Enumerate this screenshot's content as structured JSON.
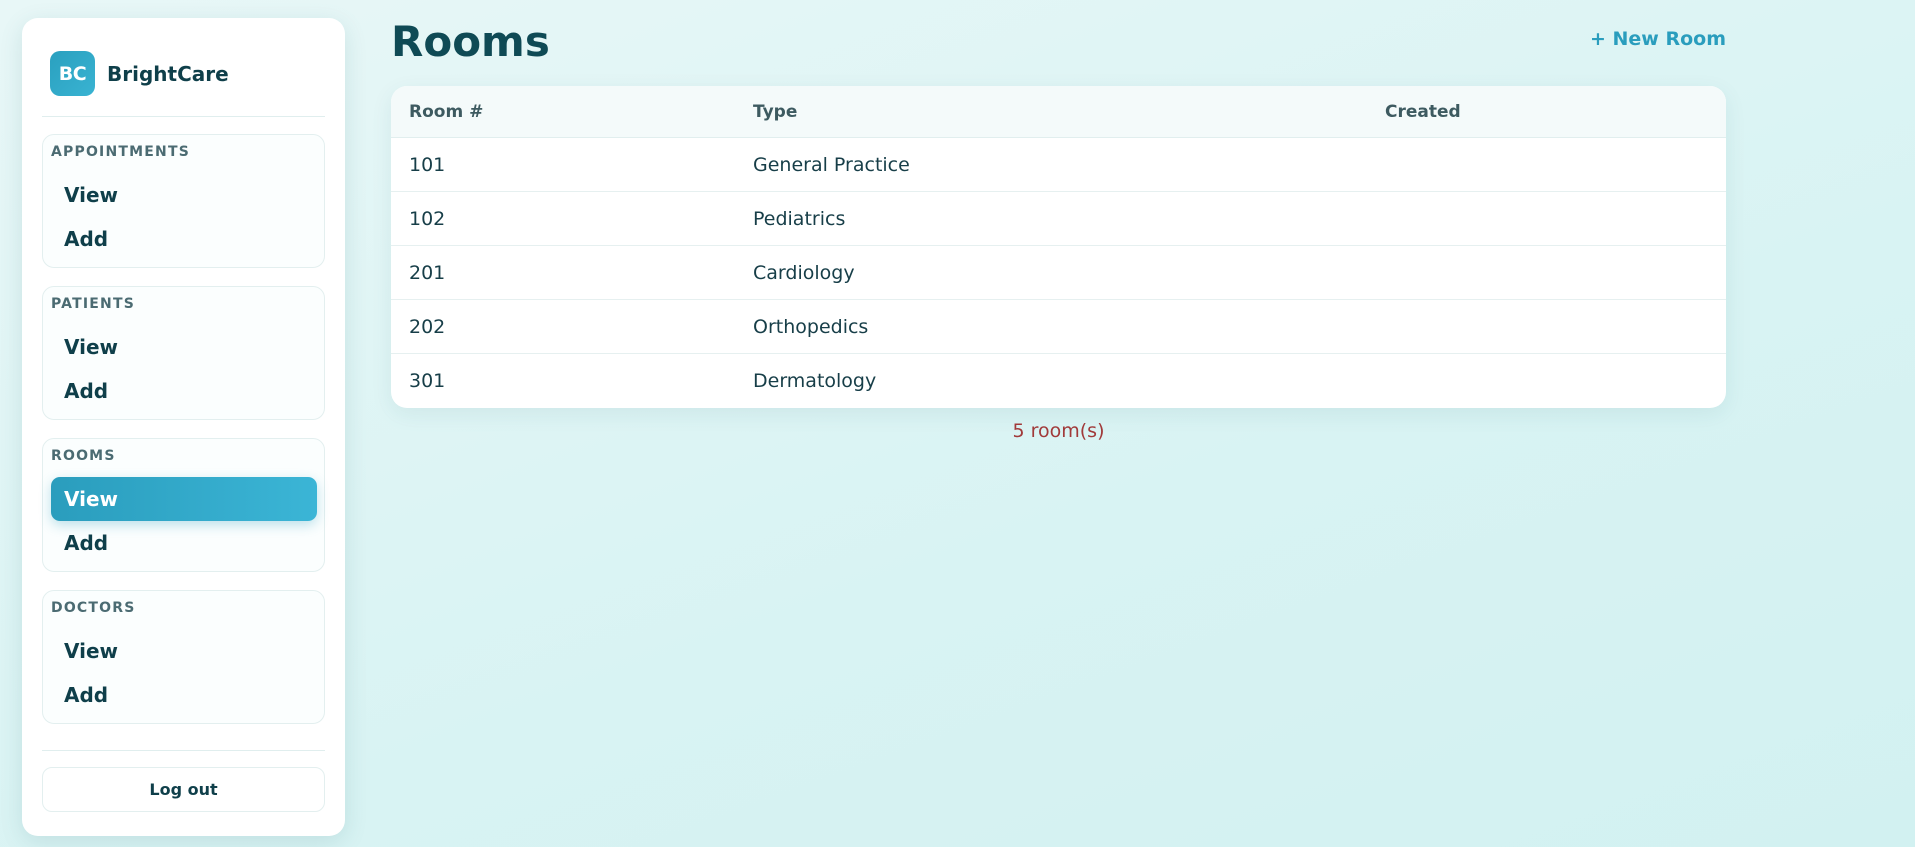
{
  "brand": {
    "logo_text": "BC",
    "name": "BrightCare"
  },
  "sidebar": {
    "groups": [
      {
        "title": "APPOINTMENTS",
        "items": [
          {
            "label": "View",
            "active": false
          },
          {
            "label": "Add",
            "active": false
          }
        ]
      },
      {
        "title": "PATIENTS",
        "items": [
          {
            "label": "View",
            "active": false
          },
          {
            "label": "Add",
            "active": false
          }
        ]
      },
      {
        "title": "ROOMS",
        "items": [
          {
            "label": "View",
            "active": true
          },
          {
            "label": "Add",
            "active": false
          }
        ]
      },
      {
        "title": "DOCTORS",
        "items": [
          {
            "label": "View",
            "active": false
          },
          {
            "label": "Add",
            "active": false
          }
        ]
      }
    ],
    "logout_label": "Log out"
  },
  "main": {
    "title": "Rooms",
    "new_button_label": "+ New Room",
    "table": {
      "columns": [
        "Room #",
        "Type",
        "Created"
      ],
      "rows": [
        {
          "room": "101",
          "type": "General Practice",
          "created": ""
        },
        {
          "room": "102",
          "type": "Pediatrics",
          "created": ""
        },
        {
          "room": "201",
          "type": "Cardiology",
          "created": ""
        },
        {
          "room": "202",
          "type": "Orthopedics",
          "created": ""
        },
        {
          "room": "301",
          "type": "Dermatology",
          "created": ""
        }
      ]
    },
    "count_text": "5 room(s)"
  },
  "colors": {
    "accent": "#2a9dbd",
    "title": "#0f4a55",
    "count_text": "#a13a3a",
    "background": "#d8f3f3"
  },
  "icons": {}
}
